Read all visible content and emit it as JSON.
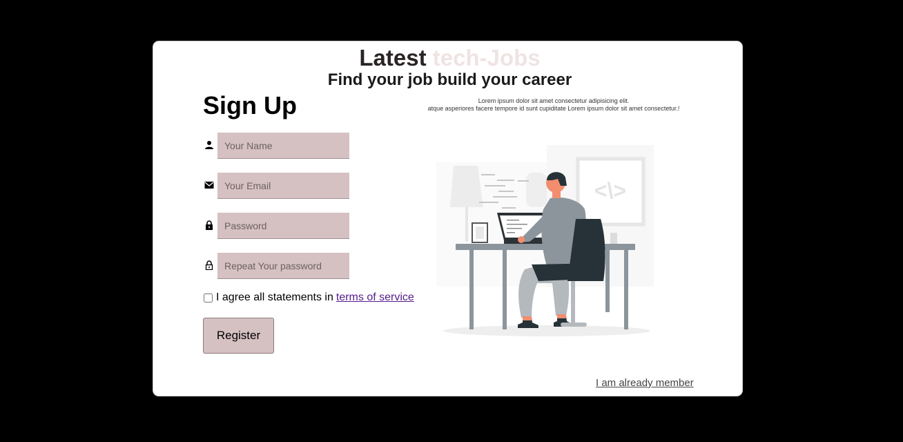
{
  "hero": {
    "title_part1": "Latest",
    "title_part2": "tech-Jobs",
    "subtitle": "Find your job build your career",
    "lorem_line1": "Lorem ipsum dolor sit amet consectetur adipisicing elit.",
    "lorem_line2": "atque asperiores facere tempore id sunt cupiditate Lorem ipsum dolor sit amet consectetur.!"
  },
  "form": {
    "title": "Sign Up",
    "fields": [
      {
        "icon": "person-icon",
        "placeholder": "Your Name",
        "value": ""
      },
      {
        "icon": "envelope-icon",
        "placeholder": "Your Email",
        "value": ""
      },
      {
        "icon": "lock-icon",
        "placeholder": "Password",
        "value": ""
      },
      {
        "icon": "lock-outline-icon",
        "placeholder": "Repeat Your password",
        "value": ""
      }
    ],
    "agree_text": "I agree all statements in",
    "terms_link": "terms of service",
    "agree_checked": false,
    "register_label": "Register"
  },
  "footer": {
    "member_link": "I am already member"
  },
  "illustration": {
    "label": "developer-at-desk-illustration"
  },
  "colors": {
    "accent": "#d5c0c2",
    "title_light": "#efe4e3",
    "link": "#551a8b"
  }
}
